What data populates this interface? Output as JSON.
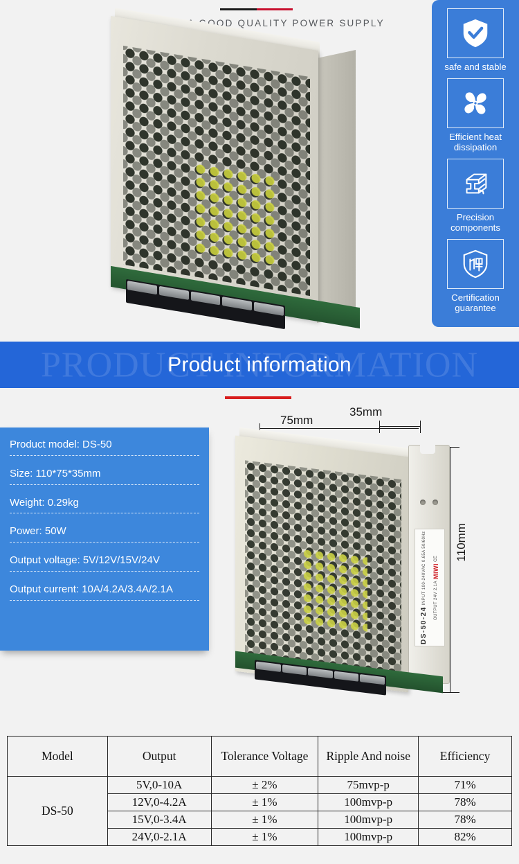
{
  "hero": {
    "tagline": "CHOOSE A GOOD QUALITY POWER SUPPLY",
    "accent_dark": "#1c1c1c",
    "accent_red": "#c8102e"
  },
  "features": {
    "bg_color": "#3b7dd8",
    "items": [
      {
        "icon": "shield-check-icon",
        "label": "safe and stable"
      },
      {
        "icon": "fan-icon",
        "label": "Efficient heat dissipation"
      },
      {
        "icon": "steel-beam-icon",
        "label": "Precision components"
      },
      {
        "icon": "warranty-shield-icon",
        "label": "Certification guarantee"
      }
    ]
  },
  "banner": {
    "title": "Product information",
    "watermark": "PRODUCT INFORMATION",
    "bg_color": "#2466d8",
    "rule_color": "#d81e1e"
  },
  "specs": {
    "bg_color": "#3d87dc",
    "rows": [
      "Product model: DS-50",
      "Size: 110*75*35mm",
      "Weight: 0.29kg",
      "Power: 50W",
      "Output voltage: 5V/12V/15V/24V",
      "Output current: 10A/4.2A/3.4A/2.1A"
    ]
  },
  "dimensions": {
    "width_label": "75mm",
    "depth_label": "35mm",
    "height_label": "110mm"
  },
  "product_label": {
    "model": "DS-50-24",
    "input": "INPUT 100-240VAC 0.65A 50/60Hz",
    "output": "OUTPUT 24V 2.1A",
    "brand": "MIWI",
    "certification": "CE"
  },
  "table": {
    "headers": [
      "Model",
      "Output",
      "Tolerance Voltage",
      "Ripple And noise",
      "Efficiency"
    ],
    "model": "DS-50",
    "rows": [
      {
        "output": "5V,0-10A",
        "tolerance": "± 2%",
        "ripple": "75mvp-p",
        "efficiency": "71%"
      },
      {
        "output": "12V,0-4.2A",
        "tolerance": "± 1%",
        "ripple": "100mvp-p",
        "efficiency": "78%"
      },
      {
        "output": "15V,0-3.4A",
        "tolerance": "± 1%",
        "ripple": "100mvp-p",
        "efficiency": "78%"
      },
      {
        "output": "24V,0-2.1A",
        "tolerance": "± 1%",
        "ripple": "100mvp-p",
        "efficiency": "82%"
      }
    ]
  }
}
